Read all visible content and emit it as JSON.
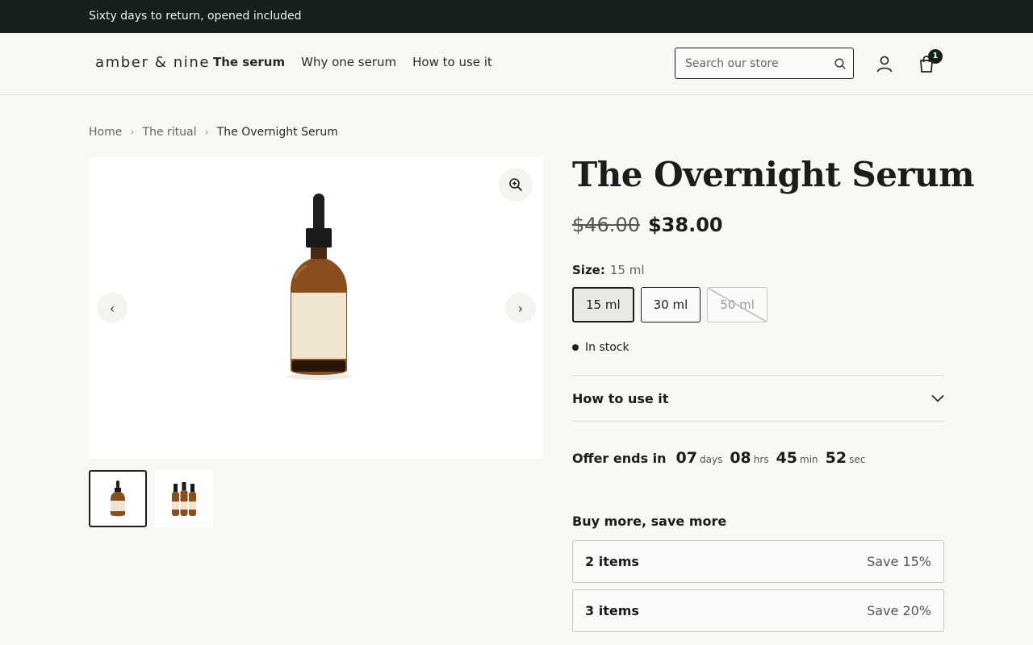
{
  "announcement": "Sixty days to return, opened included",
  "header": {
    "logo": "amber & nine",
    "nav": [
      {
        "label": "The serum"
      },
      {
        "label": "Why one serum"
      },
      {
        "label": "How to use it"
      }
    ],
    "search_placeholder": "Search our store",
    "cart_count": "1"
  },
  "breadcrumb": [
    "Home",
    "The ritual",
    "The Overnight Serum"
  ],
  "product": {
    "title": "The Overnight Serum",
    "compare_price": "$46.00",
    "price": "$38.00",
    "size_label": "Size:",
    "size_value": "15 ml",
    "sizes": [
      {
        "label": "15 ml",
        "state": "selected"
      },
      {
        "label": "30 ml",
        "state": "available"
      },
      {
        "label": "50 ml",
        "state": "unavailable"
      }
    ],
    "stock": "In stock",
    "accordion_title": "How to use it",
    "offer": {
      "label": "Offer ends in",
      "days": "07",
      "days_unit": "days",
      "hours": "08",
      "hours_unit": "hrs",
      "minutes": "45",
      "minutes_unit": "min",
      "seconds": "52",
      "seconds_unit": "sec"
    },
    "bundles": {
      "title": "Buy more, save more",
      "tiers": [
        {
          "qty": "2 items",
          "save": "Save 15%"
        },
        {
          "qty": "3 items",
          "save": "Save 20%"
        }
      ]
    }
  },
  "colors": {
    "announcement_bg": "#15201b",
    "page_bg": "#f8f7f4",
    "text": "#1c1c1c",
    "amber_bottle": "#8a4e1c",
    "label_cream": "#efe5d0"
  }
}
